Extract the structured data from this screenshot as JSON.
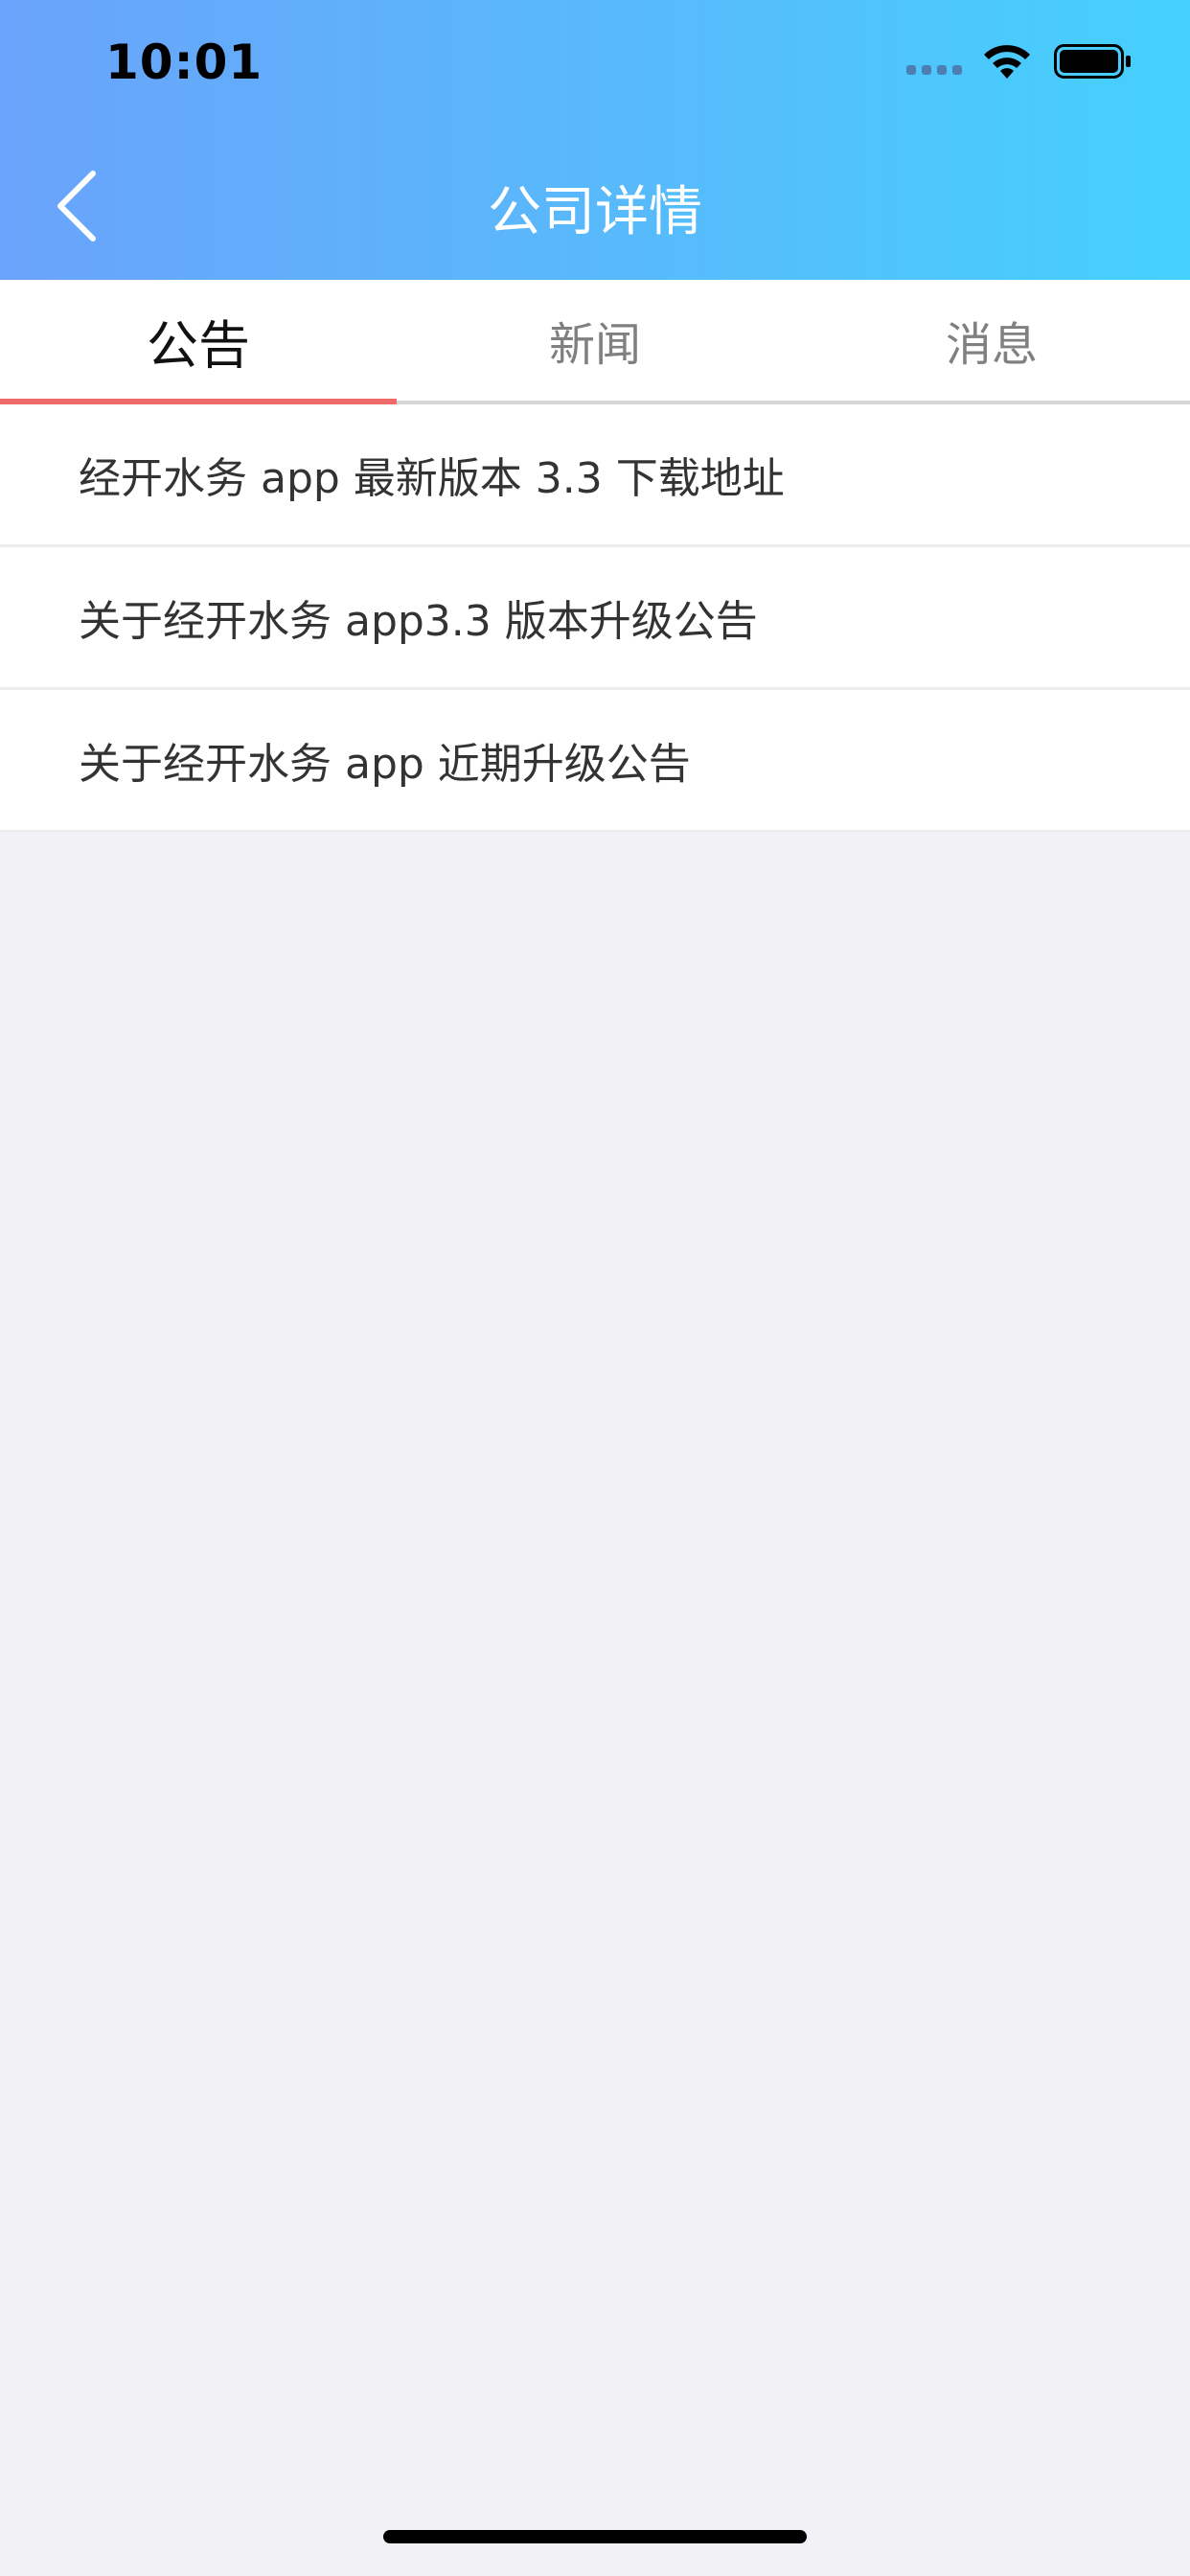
{
  "status_bar": {
    "time": "10:01"
  },
  "header": {
    "title": "公司详情"
  },
  "tabs": [
    {
      "label": "公告",
      "active": true
    },
    {
      "label": "新闻",
      "active": false
    },
    {
      "label": "消息",
      "active": false
    }
  ],
  "announcements": [
    {
      "title": "经开水务 app 最新版本 3.3 下载地址"
    },
    {
      "title": "关于经开水务 app3.3 版本升级公告"
    },
    {
      "title": "关于经开水务 app 近期升级公告"
    }
  ],
  "colors": {
    "header_gradient_start": "#6aa3fb",
    "header_gradient_end": "#45d1fd",
    "active_tab_underline": "#f06a6a",
    "background": "#f1f1f6"
  }
}
